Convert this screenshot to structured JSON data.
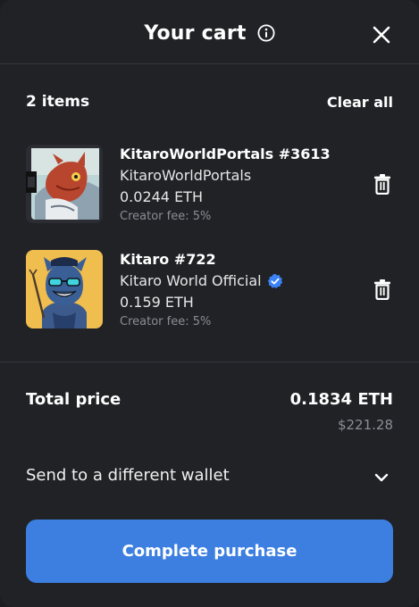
{
  "header": {
    "title": "Your cart"
  },
  "summary": {
    "count_label": "2 items",
    "clear_label": "Clear all"
  },
  "items": [
    {
      "name": "KitaroWorldPortals #3613",
      "collection": "KitaroWorldPortals",
      "price": "0.0244 ETH",
      "fee": "Creator fee: 5%",
      "verified": false
    },
    {
      "name": "Kitaro #722",
      "collection": "Kitaro World Official",
      "price": "0.159 ETH",
      "fee": "Creator fee: 5%",
      "verified": true
    }
  ],
  "total": {
    "label": "Total price",
    "eth": "0.1834 ETH",
    "usd": "$221.28"
  },
  "wallet": {
    "label": "Send to a different wallet"
  },
  "cta": {
    "label": "Complete purchase"
  },
  "colors": {
    "background": "#202226",
    "accent": "#3c7fe0",
    "muted_text": "#8a8d93",
    "verified_badge": "#3b82f6"
  },
  "icons": [
    "info-icon",
    "close-icon",
    "trash-icon",
    "verified-badge-icon",
    "chevron-down-icon"
  ]
}
